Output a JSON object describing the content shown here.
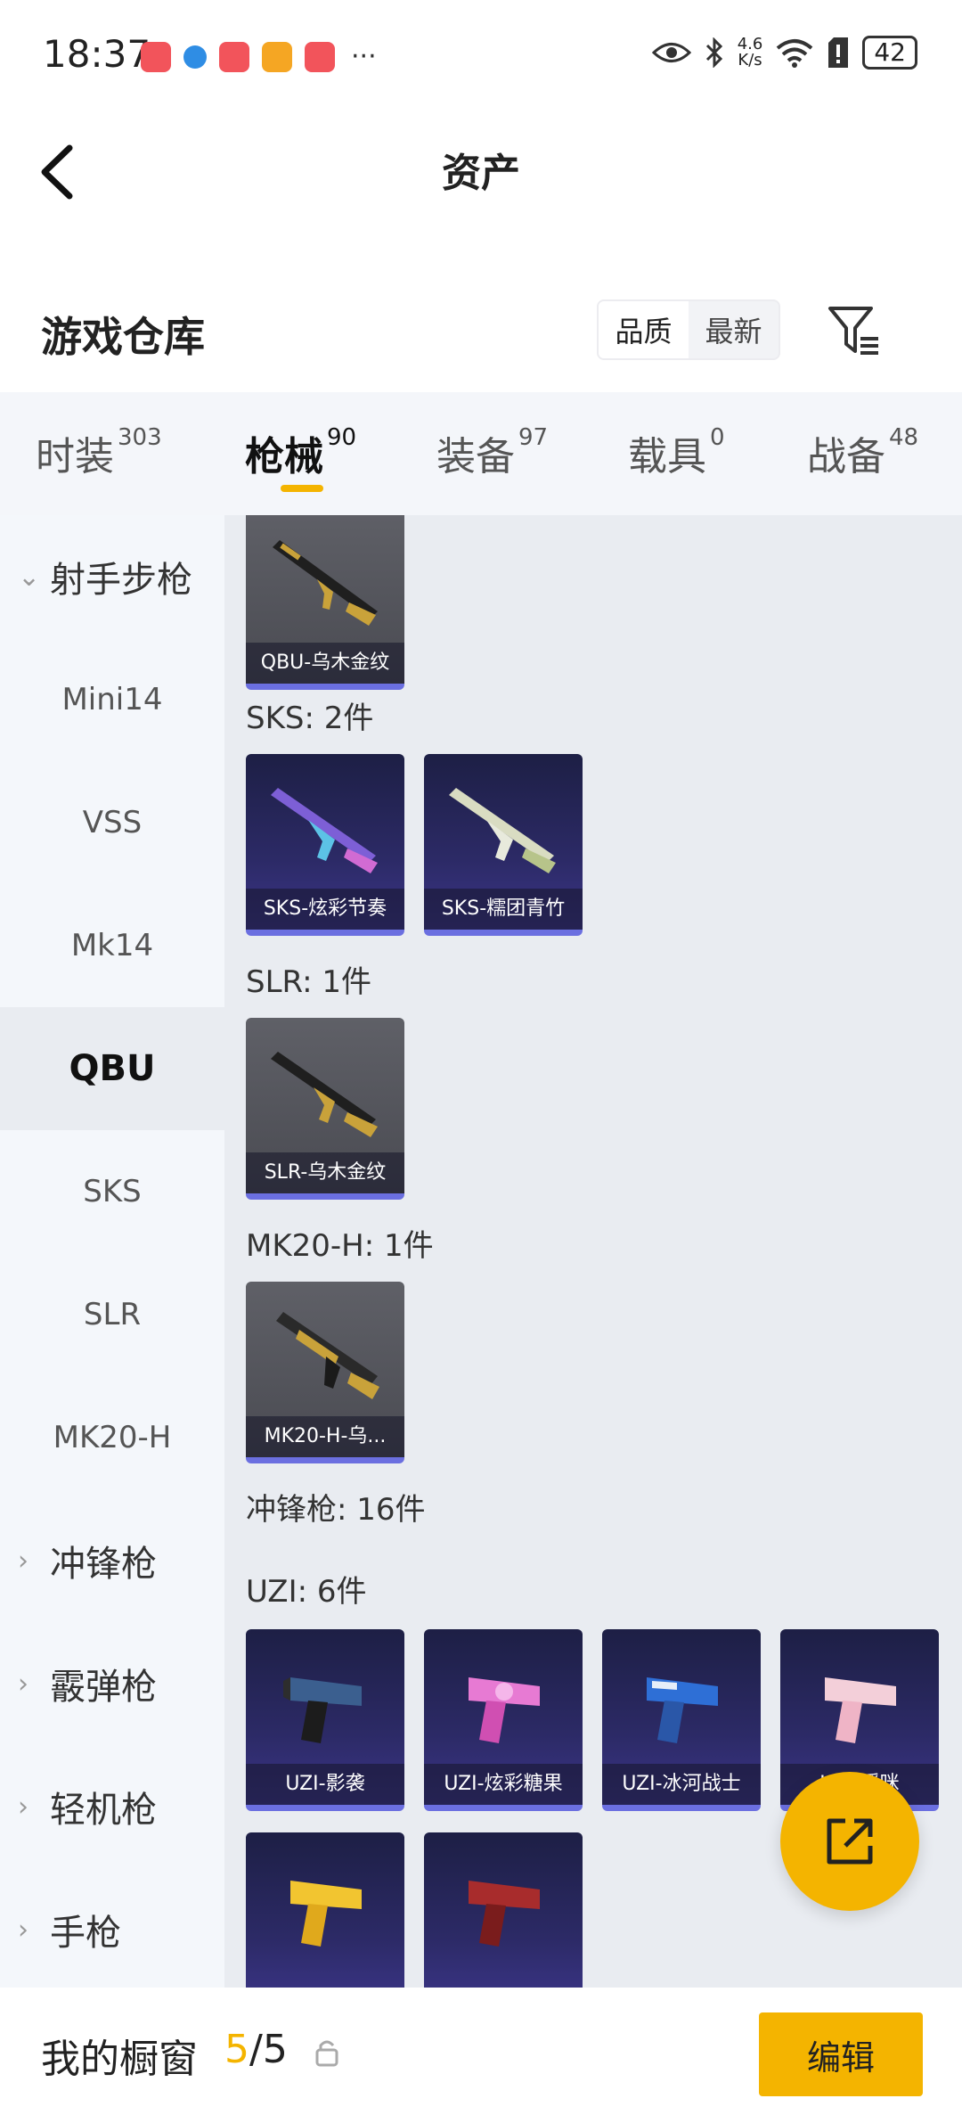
{
  "status_bar": {
    "time": "18:37",
    "dots": "···",
    "net_speed_value": "4.6",
    "net_speed_unit": "K/s",
    "battery": "42"
  },
  "nav": {
    "title": "资产"
  },
  "section": {
    "title": "游戏仓库",
    "sort_quality": "品质",
    "sort_latest": "最新"
  },
  "tabs": [
    {
      "label": "时装",
      "count": "303"
    },
    {
      "label": "枪械",
      "count": "90"
    },
    {
      "label": "装备",
      "count": "97"
    },
    {
      "label": "载具",
      "count": "0"
    },
    {
      "label": "战备",
      "count": "48"
    }
  ],
  "sidebar": {
    "groups": {
      "marksman": "射手步枪",
      "smg": "冲锋枪",
      "shotgun": "霰弹枪",
      "lmg": "轻机枪",
      "pistol": "手枪"
    },
    "items": [
      "Mini14",
      "VSS",
      "Mk14",
      "QBU",
      "SKS",
      "SLR",
      "MK20-H"
    ]
  },
  "content": {
    "labels": {
      "sks": "SKS: 2件",
      "slr": "SLR: 1件",
      "mk20": "MK20-H: 1件",
      "smg": "冲锋枪: 16件",
      "uzi": "UZI: 6件"
    },
    "cards": {
      "qbu": "QBU-乌木金纹",
      "sks1": "SKS-炫彩节奏",
      "sks2": "SKS-糯团青竹",
      "slr": "SLR-乌木金纹",
      "mk20": "MK20-H-乌...",
      "uzi1": "UZI-影袭",
      "uzi2": "UZI-炫彩糖果",
      "uzi3": "UZI-冰河战士",
      "uzi4": "UZI-暖咪"
    }
  },
  "bottom": {
    "title": "我的橱窗",
    "current": "5",
    "sep": "/",
    "total": "5",
    "edit": "编辑"
  },
  "colors": {
    "accent": "#f4b400",
    "rarity_bar": "#6b6fe0",
    "card_purple": "#2c2a66",
    "card_gray": "#55565d"
  }
}
